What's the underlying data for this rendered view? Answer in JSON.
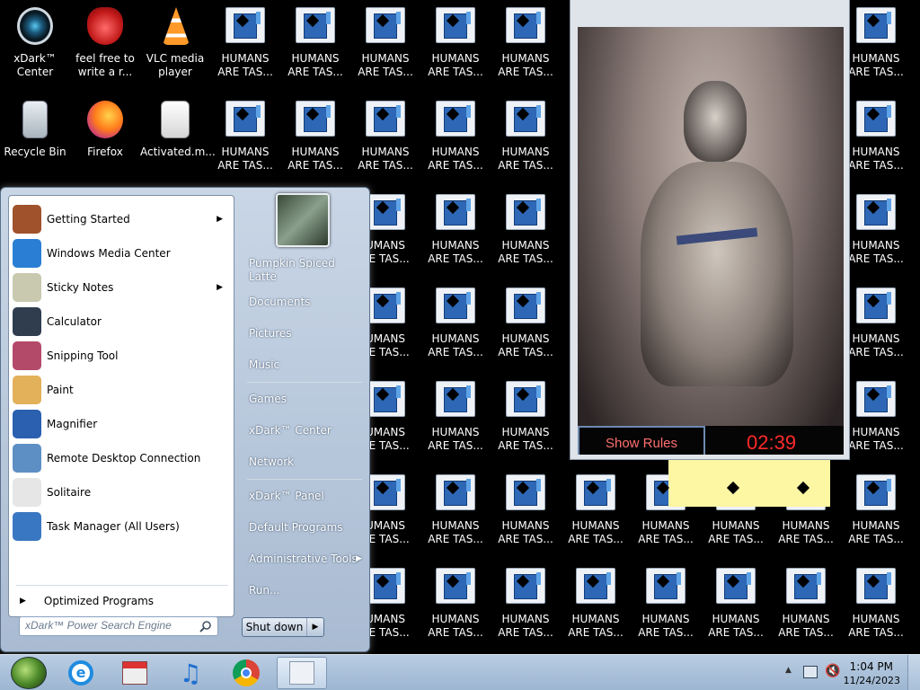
{
  "desktop": {
    "icons_col1": [
      {
        "label": "xDark™\nCenter",
        "icon": "xdark-center-icon"
      },
      {
        "label": "Recycle Bin",
        "icon": "recycle-bin-icon"
      }
    ],
    "icons_col2": [
      {
        "label": "feel free to\nwrite a r...",
        "icon": "devil-mask-icon"
      },
      {
        "label": "Firefox",
        "icon": "firefox-icon"
      }
    ],
    "icons_col3": [
      {
        "label": "VLC media\nplayer",
        "icon": "vlc-icon"
      },
      {
        "label": "Activated.m...",
        "icon": "document-icon"
      }
    ],
    "humans_label": "HUMANS\nARE TAS...",
    "humans_partial_label": "UMANS\nRE TAS..."
  },
  "start_menu": {
    "pinned": [
      {
        "label": "Getting Started",
        "has_submenu": true,
        "color": "#a0522d"
      },
      {
        "label": "Windows Media Center",
        "has_submenu": false,
        "color": "#2a7fd4"
      },
      {
        "label": "Sticky Notes",
        "has_submenu": true,
        "color": "#c9c9b0"
      },
      {
        "label": "Calculator",
        "has_submenu": false,
        "color": "#2f3d4f"
      },
      {
        "label": "Snipping Tool",
        "has_submenu": false,
        "color": "#b44a6a"
      },
      {
        "label": "Paint",
        "has_submenu": false,
        "color": "#e3b15a"
      },
      {
        "label": "Magnifier",
        "has_submenu": false,
        "color": "#2b5fb0"
      },
      {
        "label": "Remote Desktop Connection",
        "has_submenu": false,
        "color": "#5d8fc4"
      },
      {
        "label": "Solitaire",
        "has_submenu": false,
        "color": "#e6e6e6"
      },
      {
        "label": "Task Manager (All Users)",
        "has_submenu": false,
        "color": "#3a77c2"
      }
    ],
    "all_programs": "Optimized Programs",
    "search_placeholder": "xDark™ Power Search Engine",
    "right": {
      "user": "Pumpkin Spiced\nLatte",
      "documents": "Documents",
      "pictures": "Pictures",
      "music": "Music",
      "games": "Games",
      "xdark_center": "xDark™ Center",
      "network": "Network",
      "xdark_panel": "xDark™ Panel",
      "default_programs": "Default Programs",
      "admin_tools": "Administrative Tools",
      "run": "Run..."
    },
    "shutdown": "Shut down"
  },
  "video_window": {
    "show_rules": "Show Rules",
    "timer": "02:39"
  },
  "taskbar": {
    "clock_time": "1:04 PM",
    "clock_date": "11/24/2023"
  }
}
